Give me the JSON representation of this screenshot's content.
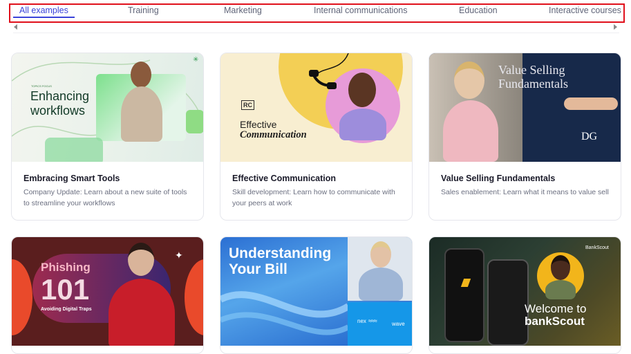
{
  "tabs": [
    {
      "label": "All examples",
      "active": true
    },
    {
      "label": "Training",
      "active": false
    },
    {
      "label": "Marketing",
      "active": false
    },
    {
      "label": "Internal communications",
      "active": false
    },
    {
      "label": "Education",
      "active": false
    },
    {
      "label": "Interactive courses",
      "active": false
    }
  ],
  "cards": [
    {
      "title": "Embracing Smart Tools",
      "description": "Company Update: Learn about a new suite of tools to streamline your workflows",
      "thumb_lines": [
        "Enhancing",
        "workflows"
      ],
      "thumb_small": "TOPICS FOCUS"
    },
    {
      "title": "Effective Communication",
      "description": "Skill development: Learn how to communicate with your peers at work",
      "thumb_badge": "RC",
      "thumb_lines": [
        "Effective",
        "Communication"
      ]
    },
    {
      "title": "Value Selling Fundamentals",
      "description": "Sales enablement: Learn what it means to value sell",
      "thumb_lines": [
        "Value Selling",
        "Fundamentals"
      ],
      "thumb_badge": "DG"
    },
    {
      "title": "",
      "description": "",
      "thumb_lines": [
        "Phishing",
        "101"
      ],
      "thumb_small": "Avoiding Digital Traps"
    },
    {
      "title": "",
      "description": "",
      "thumb_lines": [
        "Understanding",
        "Your Bill"
      ],
      "thumb_badge": "nex",
      "thumb_badge2": "wave"
    },
    {
      "title": "",
      "description": "",
      "thumb_lines": [
        "Welcome to",
        "bankScout"
      ],
      "thumb_badge": "BankScout"
    }
  ],
  "colors": {
    "accent": "#3a43d9",
    "highlight_border": "#e0101b"
  }
}
